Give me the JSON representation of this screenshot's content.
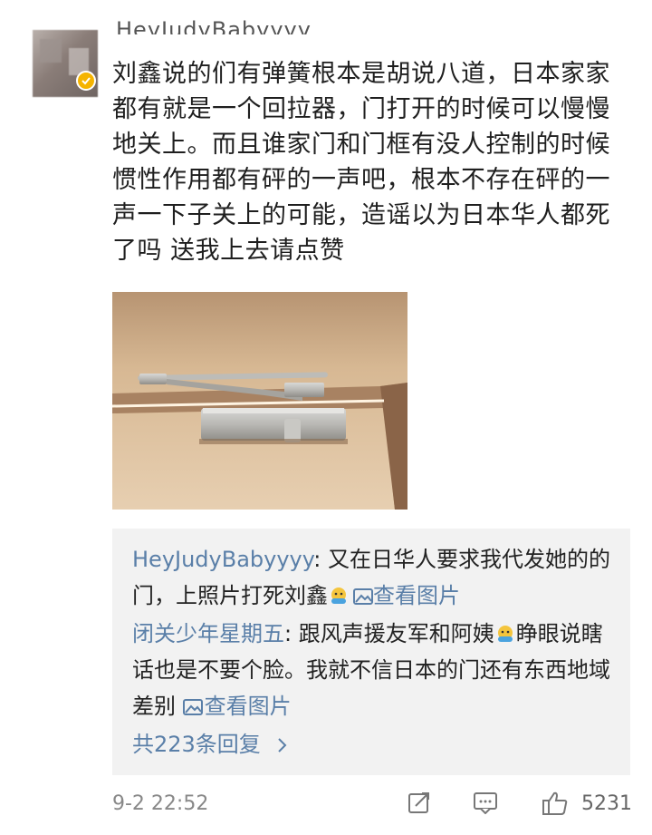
{
  "comment": {
    "username": "HeyJudyBabyyyy",
    "text": "刘鑫说的们有弹簧根本是胡说八道，日本家家都有就是一个回拉器，门打开的时候可以慢慢地关上。而且谁家门和门框有没人控制的时候惯性作用都有砰的一声吧，根本不存在砰的一声一下子关上的可能，造谣以为日本华人都死了吗 送我上去请点赞",
    "photo_icon": "door-closer-photo",
    "badge_icon": "verified-badge-icon"
  },
  "replies": [
    {
      "name": "HeyJudyBabyyyy",
      "separator": ":",
      "text_before": " 又在日华人要求我代发她的的门，上照片打死刘鑫",
      "emoji_icon": "emoji-icon",
      "link_icon": "image-icon",
      "link": "查看图片"
    },
    {
      "name": "闭关少年星期五",
      "separator": ":",
      "text_before": " 跟风声援友军和阿姨",
      "emoji_icon": "emoji-icon",
      "text_after": "睁眼说瞎话也是不要个脸。我就不信日本的门还有东西地域差别 ",
      "link_icon": "image-icon",
      "link": "查看图片"
    }
  ],
  "more_replies": "共223条回复",
  "footer": {
    "time": "9-2 22:52",
    "likes": "5231",
    "share_icon": "share-icon",
    "comment_icon": "comment-icon",
    "like_icon": "thumbs-up-icon"
  },
  "colors": {
    "link": "#5a7fa8",
    "reply_bg": "#f2f2f2",
    "badge": "#f5b400"
  }
}
